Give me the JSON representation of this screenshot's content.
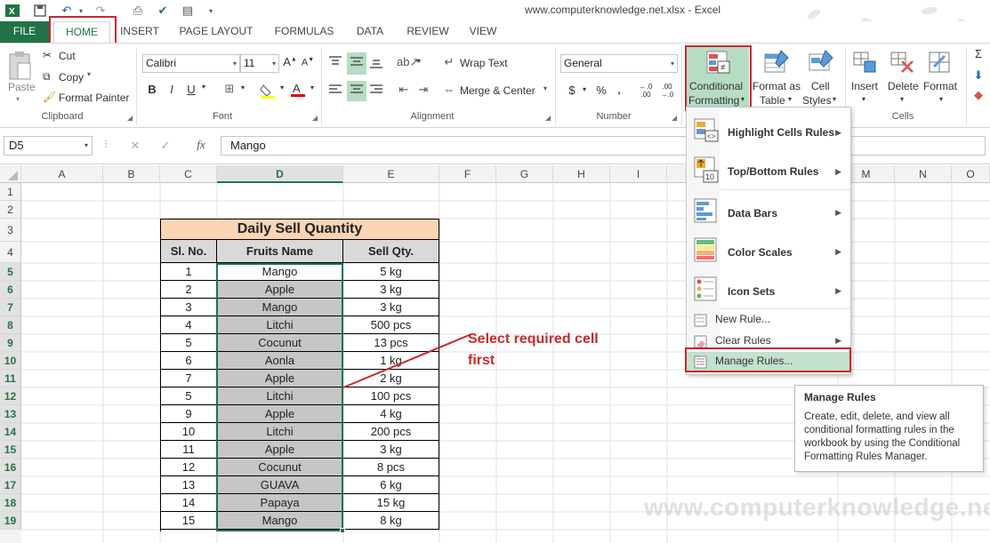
{
  "title": "www.computerknowledge.net.xlsx - Excel",
  "tabs": [
    "FILE",
    "HOME",
    "INSERT",
    "PAGE LAYOUT",
    "FORMULAS",
    "DATA",
    "REVIEW",
    "VIEW"
  ],
  "ribbon": {
    "clipboard": {
      "paste": "Paste",
      "cut": "Cut",
      "copy": "Copy",
      "format_painter": "Format Painter",
      "label": "Clipboard"
    },
    "font": {
      "name": "Calibri",
      "size": "11",
      "label": "Font",
      "bold": "B",
      "italic": "I",
      "underline": "U"
    },
    "alignment": {
      "wrap_text": "Wrap Text",
      "merge_center": "Merge & Center",
      "label": "Alignment"
    },
    "number": {
      "format": "General",
      "currency": "$",
      "percent": "%",
      "comma": ",",
      "label": "Number"
    },
    "styles": {
      "conditional_formatting_1": "Conditional",
      "conditional_formatting_2": "Formatting",
      "format_as_1": "Format as",
      "format_as_2": "Table",
      "cell_styles_1": "Cell",
      "cell_styles_2": "Styles"
    },
    "cells": {
      "insert": "Insert",
      "delete": "Delete",
      "format": "Format",
      "label": "Cells"
    }
  },
  "formula_bar": {
    "name_box": "D5",
    "fx": "fx",
    "value": "Mango"
  },
  "columns": [
    "A",
    "B",
    "C",
    "D",
    "E",
    "F",
    "G",
    "H",
    "I",
    "M",
    "N",
    "O"
  ],
  "rows": [
    "1",
    "2",
    "3",
    "4",
    "5",
    "6",
    "7",
    "8",
    "9",
    "10",
    "11",
    "12",
    "13",
    "14",
    "15",
    "16",
    "17",
    "18",
    "19"
  ],
  "table": {
    "title": "Daily Sell Quantity",
    "headers": [
      "Sl. No.",
      "Fruits Name",
      "Sell Qty."
    ],
    "rows": [
      [
        "1",
        "Mango",
        "5 kg"
      ],
      [
        "2",
        "Apple",
        "3 kg"
      ],
      [
        "3",
        "Mango",
        "3 kg"
      ],
      [
        "4",
        "Litchi",
        "500 pcs"
      ],
      [
        "5",
        "Cocunut",
        "13 pcs"
      ],
      [
        "6",
        "Aonla",
        "1 kg"
      ],
      [
        "7",
        "Apple",
        "2 kg"
      ],
      [
        "5",
        "Litchi",
        "100 pcs"
      ],
      [
        "9",
        "Apple",
        "4 kg"
      ],
      [
        "10",
        "Litchi",
        "200 pcs"
      ],
      [
        "11",
        "Apple",
        "3 kg"
      ],
      [
        "12",
        "Cocunut",
        "8 pcs"
      ],
      [
        "13",
        "GUAVA",
        "6 kg"
      ],
      [
        "14",
        "Papaya",
        "15 kg"
      ],
      [
        "15",
        "Mango",
        "8 kg"
      ]
    ]
  },
  "annotation": {
    "line1": "Select required cell",
    "line2": "first"
  },
  "menu": {
    "items": [
      "Highlight Cells Rules",
      "Top/Bottom Rules",
      "Data Bars",
      "Color Scales",
      "Icon Sets"
    ],
    "small_items": [
      "New Rule...",
      "Clear Rules",
      "Manage Rules..."
    ]
  },
  "tooltip": {
    "title": "Manage Rules",
    "body": "Create, edit, delete, and view all conditional formatting rules in the workbook by using the Conditional Formatting Rules Manager."
  },
  "watermark": "www.computerknowledge.net",
  "colors": {
    "excel_green": "#217346",
    "highlight_red": "#c8292c",
    "header_peach": "#fbd4b4",
    "selected_gray": "#c6c6c6"
  }
}
